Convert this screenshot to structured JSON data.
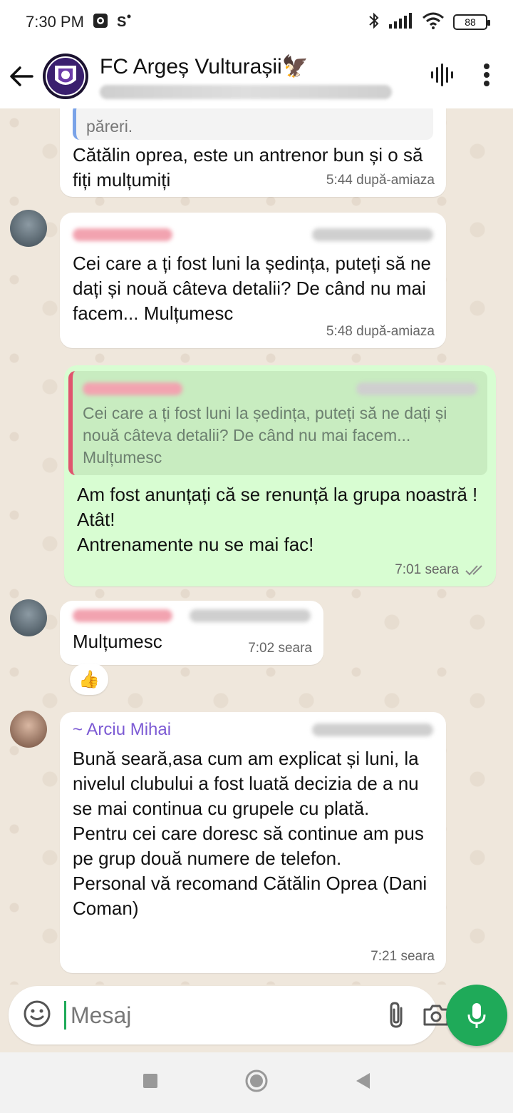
{
  "status_bar": {
    "time": "7:30 PM",
    "battery": "88"
  },
  "header": {
    "title": "FC Argeș Vulturașii🦅"
  },
  "messages": {
    "m1": {
      "quote_tail": "păreri.",
      "text": "Cătălin oprea, este un antrenor bun și o să fiți mulțumiți",
      "time": "5:44 după-amiaza"
    },
    "m2": {
      "text": "Cei care a ți fost luni la ședința, puteți să ne dați și nouă câteva detalii? De când nu mai facem... Mulțumesc",
      "time": "5:48 după-amiaza"
    },
    "m3": {
      "quote_text": "Cei care a ți fost luni la ședința, puteți să ne dați și nouă câteva detalii? De când nu mai facem... Mulțumesc",
      "line1": "Am fost anunțați că se renunță la grupa noastră !",
      "line2": "Atât!",
      "line3": "Antrenamente nu se mai fac!",
      "time": "7:01 seara"
    },
    "m4": {
      "text": "Mulțumesc",
      "time": "7:02 seara",
      "reaction": "👍"
    },
    "m5": {
      "sender": "~ Arciu Mihai",
      "line1": "Bună seară,asa cum am explicat și luni, la nivelul clubului a fost luată decizia de a nu se mai continua cu grupele cu plată.",
      "line2": "Pentru cei care doresc să  continue am pus pe grup două numere de telefon.",
      "line3": "Personal vă recomand Cătălin Oprea (Dani Coman)",
      "time": "7:21 seara"
    }
  },
  "composer": {
    "placeholder": "Mesaj"
  },
  "colors": {
    "accent": "#1faa59",
    "outgoing_bubble": "#d8fdd2",
    "sender_name": "#7c5ad4",
    "quote_bar": "#e0546e"
  }
}
